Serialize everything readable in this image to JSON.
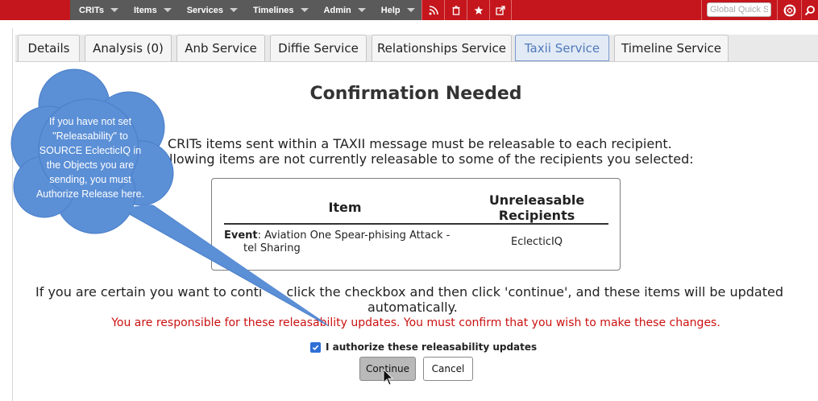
{
  "navbar": {
    "menus": [
      {
        "label": "CRITs"
      },
      {
        "label": "Items"
      },
      {
        "label": "Services"
      },
      {
        "label": "Timelines"
      },
      {
        "label": "Admin"
      },
      {
        "label": "Help"
      }
    ],
    "icons": [
      "rss-icon",
      "trash-icon",
      "star-icon",
      "external-link-icon"
    ],
    "search_placeholder": "Global Quick Search",
    "right_icons": [
      "help-ring-icon",
      "search-icon"
    ],
    "bar_color": "#c4161c"
  },
  "tabs": [
    {
      "label": "Details"
    },
    {
      "label": "Analysis (0)"
    },
    {
      "label": "Anb Service"
    },
    {
      "label": "Diffie Service"
    },
    {
      "label": "Relationships Service"
    },
    {
      "label": "Taxii Service",
      "active": true
    },
    {
      "label": "Timeline Service"
    }
  ],
  "page": {
    "title": "Confirmation Needed",
    "intro_line1": "CRITs items sent within a TAXII message must be releasable to each recipient.",
    "intro_line2": "llowing items are not currently releasable to some of the recipients you selected:",
    "table": {
      "col_item": "Item",
      "col_recipients_line1": "Unreleasable",
      "col_recipients_line2": "Recipients",
      "row": {
        "type_label": "Event",
        "name_line1": ": Aviation One Spear-phising Attack -",
        "name_line2": "tel Sharing",
        "recipient": "EclecticIQ"
      }
    },
    "continue_line1": "If you are certain you want to conti",
    "continue_line1b": ", click the checkbox and then click 'continue', and these items will be updated",
    "continue_line2": "automatically.",
    "warning": "You are responsible for these releasability updates. You must confirm that you wish to make these changes.",
    "authorize_label": "I authorize these releasability updates",
    "authorize_checked": true,
    "continue_button": "Continue",
    "cancel_button": "Cancel",
    "warning_color": "#cc1111"
  },
  "callout": {
    "lines": [
      "If you have not set",
      "\"Releasability\" to",
      "SOURCE EclecticIQ in",
      "the Objects you are",
      "sending, you must",
      "Authorize Release here."
    ],
    "color": "#5b8fd6"
  }
}
